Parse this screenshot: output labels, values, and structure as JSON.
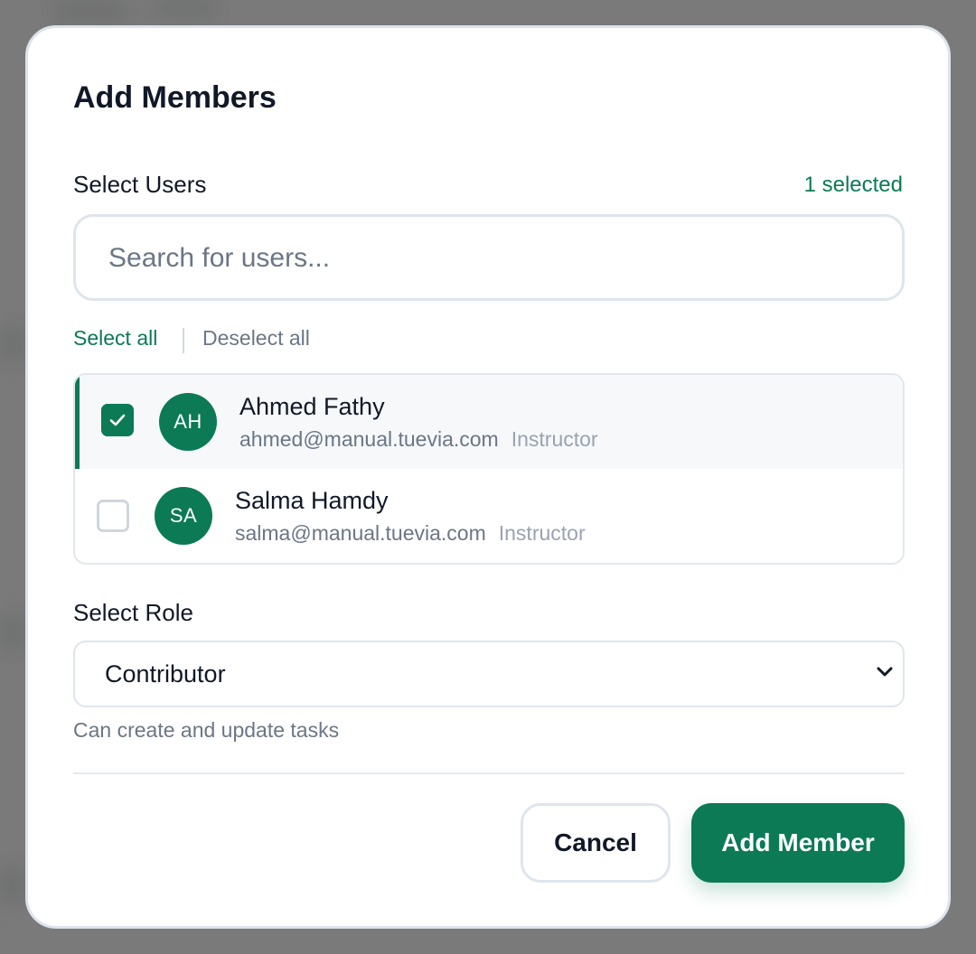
{
  "modal": {
    "title": "Add Members"
  },
  "users_section": {
    "label": "Select Users",
    "selected_count": "1 selected",
    "search_placeholder": "Search for users...",
    "select_all": "Select all",
    "deselect_all": "Deselect all",
    "users": [
      {
        "initials": "AH",
        "name": "Ahmed Fathy",
        "email": "ahmed@manual.tuevia.com",
        "role": "Instructor",
        "selected": true
      },
      {
        "initials": "SA",
        "name": "Salma Hamdy",
        "email": "salma@manual.tuevia.com",
        "role": "Instructor",
        "selected": false
      }
    ]
  },
  "role_section": {
    "label": "Select Role",
    "selected_role": "Contributor",
    "help_text": "Can create and update tasks"
  },
  "actions": {
    "cancel": "Cancel",
    "submit": "Add Member"
  },
  "colors": {
    "accent": "#0b7a55",
    "overlay": "#7a7a7a"
  }
}
